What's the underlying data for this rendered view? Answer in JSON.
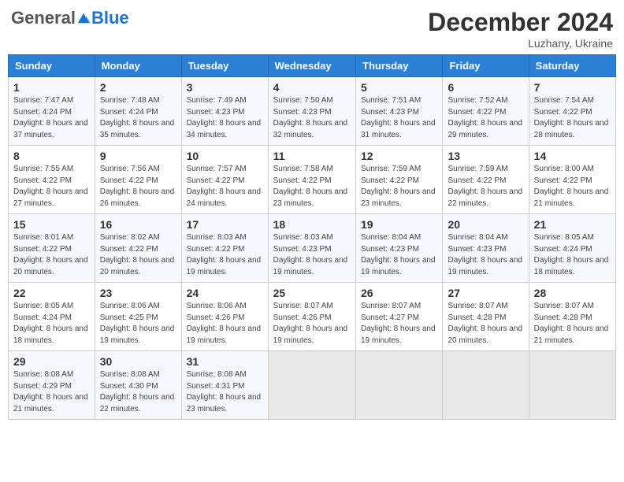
{
  "header": {
    "logo_general": "General",
    "logo_blue": "Blue",
    "month": "December 2024",
    "location": "Luzhany, Ukraine"
  },
  "weekdays": [
    "Sunday",
    "Monday",
    "Tuesday",
    "Wednesday",
    "Thursday",
    "Friday",
    "Saturday"
  ],
  "weeks": [
    [
      {
        "day": "1",
        "sunrise": "7:47 AM",
        "sunset": "4:24 PM",
        "daylight": "8 hours and 37 minutes."
      },
      {
        "day": "2",
        "sunrise": "7:48 AM",
        "sunset": "4:24 PM",
        "daylight": "8 hours and 35 minutes."
      },
      {
        "day": "3",
        "sunrise": "7:49 AM",
        "sunset": "4:23 PM",
        "daylight": "8 hours and 34 minutes."
      },
      {
        "day": "4",
        "sunrise": "7:50 AM",
        "sunset": "4:23 PM",
        "daylight": "8 hours and 32 minutes."
      },
      {
        "day": "5",
        "sunrise": "7:51 AM",
        "sunset": "4:23 PM",
        "daylight": "8 hours and 31 minutes."
      },
      {
        "day": "6",
        "sunrise": "7:52 AM",
        "sunset": "4:22 PM",
        "daylight": "8 hours and 29 minutes."
      },
      {
        "day": "7",
        "sunrise": "7:54 AM",
        "sunset": "4:22 PM",
        "daylight": "8 hours and 28 minutes."
      }
    ],
    [
      {
        "day": "8",
        "sunrise": "7:55 AM",
        "sunset": "4:22 PM",
        "daylight": "8 hours and 27 minutes."
      },
      {
        "day": "9",
        "sunrise": "7:56 AM",
        "sunset": "4:22 PM",
        "daylight": "8 hours and 26 minutes."
      },
      {
        "day": "10",
        "sunrise": "7:57 AM",
        "sunset": "4:22 PM",
        "daylight": "8 hours and 24 minutes."
      },
      {
        "day": "11",
        "sunrise": "7:58 AM",
        "sunset": "4:22 PM",
        "daylight": "8 hours and 23 minutes."
      },
      {
        "day": "12",
        "sunrise": "7:59 AM",
        "sunset": "4:22 PM",
        "daylight": "8 hours and 23 minutes."
      },
      {
        "day": "13",
        "sunrise": "7:59 AM",
        "sunset": "4:22 PM",
        "daylight": "8 hours and 22 minutes."
      },
      {
        "day": "14",
        "sunrise": "8:00 AM",
        "sunset": "4:22 PM",
        "daylight": "8 hours and 21 minutes."
      }
    ],
    [
      {
        "day": "15",
        "sunrise": "8:01 AM",
        "sunset": "4:22 PM",
        "daylight": "8 hours and 20 minutes."
      },
      {
        "day": "16",
        "sunrise": "8:02 AM",
        "sunset": "4:22 PM",
        "daylight": "8 hours and 20 minutes."
      },
      {
        "day": "17",
        "sunrise": "8:03 AM",
        "sunset": "4:22 PM",
        "daylight": "8 hours and 19 minutes."
      },
      {
        "day": "18",
        "sunrise": "8:03 AM",
        "sunset": "4:23 PM",
        "daylight": "8 hours and 19 minutes."
      },
      {
        "day": "19",
        "sunrise": "8:04 AM",
        "sunset": "4:23 PM",
        "daylight": "8 hours and 19 minutes."
      },
      {
        "day": "20",
        "sunrise": "8:04 AM",
        "sunset": "4:23 PM",
        "daylight": "8 hours and 19 minutes."
      },
      {
        "day": "21",
        "sunrise": "8:05 AM",
        "sunset": "4:24 PM",
        "daylight": "8 hours and 18 minutes."
      }
    ],
    [
      {
        "day": "22",
        "sunrise": "8:05 AM",
        "sunset": "4:24 PM",
        "daylight": "8 hours and 18 minutes."
      },
      {
        "day": "23",
        "sunrise": "8:06 AM",
        "sunset": "4:25 PM",
        "daylight": "8 hours and 19 minutes."
      },
      {
        "day": "24",
        "sunrise": "8:06 AM",
        "sunset": "4:26 PM",
        "daylight": "8 hours and 19 minutes."
      },
      {
        "day": "25",
        "sunrise": "8:07 AM",
        "sunset": "4:26 PM",
        "daylight": "8 hours and 19 minutes."
      },
      {
        "day": "26",
        "sunrise": "8:07 AM",
        "sunset": "4:27 PM",
        "daylight": "8 hours and 19 minutes."
      },
      {
        "day": "27",
        "sunrise": "8:07 AM",
        "sunset": "4:28 PM",
        "daylight": "8 hours and 20 minutes."
      },
      {
        "day": "28",
        "sunrise": "8:07 AM",
        "sunset": "4:28 PM",
        "daylight": "8 hours and 21 minutes."
      }
    ],
    [
      {
        "day": "29",
        "sunrise": "8:08 AM",
        "sunset": "4:29 PM",
        "daylight": "8 hours and 21 minutes."
      },
      {
        "day": "30",
        "sunrise": "8:08 AM",
        "sunset": "4:30 PM",
        "daylight": "8 hours and 22 minutes."
      },
      {
        "day": "31",
        "sunrise": "8:08 AM",
        "sunset": "4:31 PM",
        "daylight": "8 hours and 23 minutes."
      },
      null,
      null,
      null,
      null
    ]
  ],
  "labels": {
    "sunrise": "Sunrise:",
    "sunset": "Sunset:",
    "daylight": "Daylight:"
  }
}
